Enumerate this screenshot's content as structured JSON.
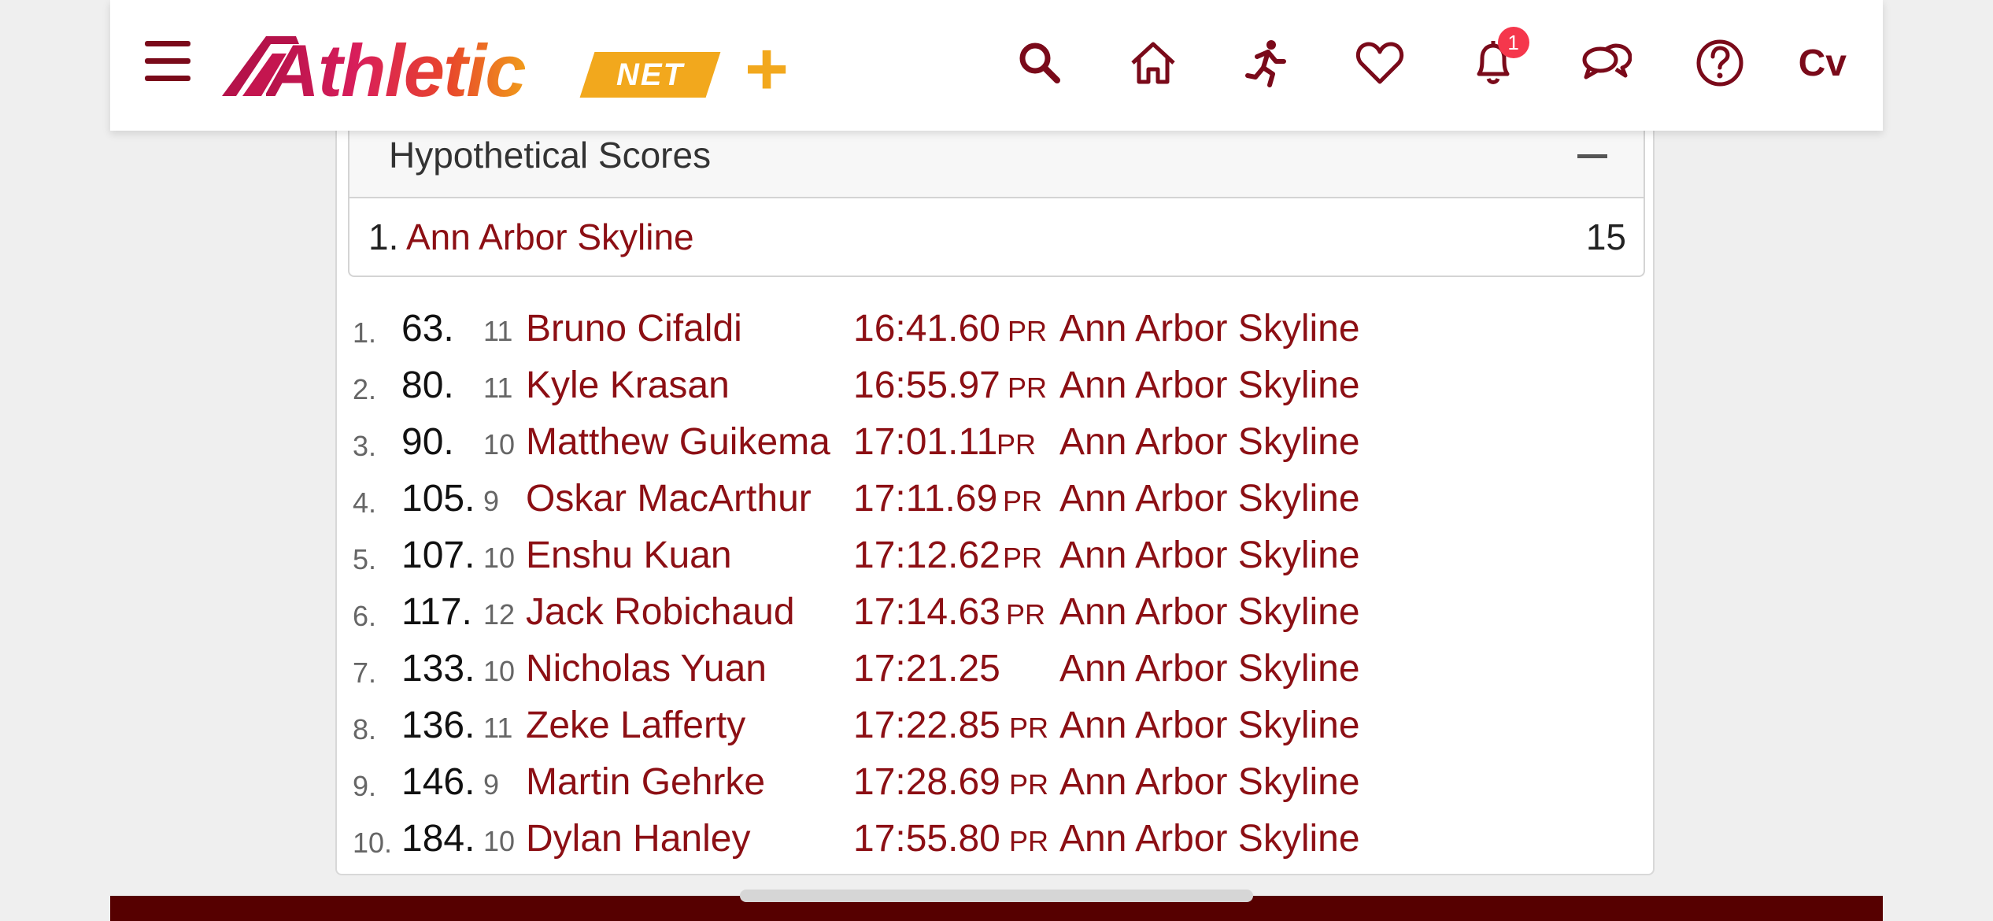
{
  "header": {
    "logo_text": "Athletic",
    "logo_net": "NET",
    "logo_plus": "+",
    "notification_count": "1",
    "user_initials": "Cv",
    "icons": [
      "menu-icon",
      "search-icon",
      "home-icon",
      "runner-icon",
      "heart-icon",
      "bell-icon",
      "chat-icon",
      "help-icon"
    ],
    "brand_color": "#7a0a1a"
  },
  "hypothetical_scores": {
    "title": "Hypothetical Scores",
    "teams": [
      {
        "rank": "1.",
        "name": "Ann Arbor Skyline",
        "score": "15"
      }
    ]
  },
  "results": [
    {
      "idx": "1.",
      "place": "63.",
      "grade": "11",
      "name": "Bruno Cifaldi",
      "time": "16:41.60",
      "pr": "PR",
      "team": "Ann Arbor Skyline"
    },
    {
      "idx": "2.",
      "place": "80.",
      "grade": "11",
      "name": "Kyle Krasan",
      "time": "16:55.97",
      "pr": "PR",
      "team": "Ann Arbor Skyline"
    },
    {
      "idx": "3.",
      "place": "90.",
      "grade": "10",
      "name": "Matthew Guikema",
      "time": "17:01.11",
      "pr": "PR",
      "team": "Ann Arbor Skyline"
    },
    {
      "idx": "4.",
      "place": "105.",
      "grade": "9",
      "name": "Oskar MacArthur",
      "time": "17:11.69",
      "pr": "PR",
      "team": "Ann Arbor Skyline"
    },
    {
      "idx": "5.",
      "place": "107.",
      "grade": "10",
      "name": "Enshu Kuan",
      "time": "17:12.62",
      "pr": "PR",
      "team": "Ann Arbor Skyline"
    },
    {
      "idx": "6.",
      "place": "117.",
      "grade": "12",
      "name": "Jack Robichaud",
      "time": "17:14.63",
      "pr": "PR",
      "team": "Ann Arbor Skyline"
    },
    {
      "idx": "7.",
      "place": "133.",
      "grade": "10",
      "name": "Nicholas Yuan",
      "time": "17:21.25",
      "pr": "",
      "team": "Ann Arbor Skyline"
    },
    {
      "idx": "8.",
      "place": "136.",
      "grade": "11",
      "name": "Zeke Lafferty",
      "time": "17:22.85",
      "pr": "PR",
      "team": "Ann Arbor Skyline"
    },
    {
      "idx": "9.",
      "place": "146.",
      "grade": "9",
      "name": "Martin Gehrke",
      "time": "17:28.69",
      "pr": "PR",
      "team": "Ann Arbor Skyline"
    },
    {
      "idx": "10.",
      "place": "184.",
      "grade": "10",
      "name": "Dylan Hanley",
      "time": "17:55.80",
      "pr": "PR",
      "team": "Ann Arbor Skyline"
    }
  ]
}
